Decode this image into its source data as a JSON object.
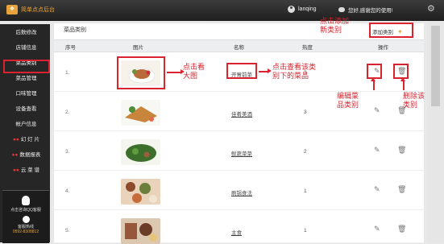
{
  "topbar": {
    "logo_mark": "❖",
    "logo_text": "简单点点后台",
    "username": "lanqing",
    "message": "您好,感谢您的使用!",
    "settings_icon": "gear-icon"
  },
  "sidebar": {
    "items": [
      {
        "label": "后数修改",
        "tag": ""
      },
      {
        "label": "店铺信息",
        "tag": ""
      },
      {
        "label": "菜品类别",
        "tag": "",
        "active": true
      },
      {
        "label": "菜品管理",
        "tag": ""
      },
      {
        "label": "口味管理",
        "tag": ""
      },
      {
        "label": "设备查看",
        "tag": ""
      },
      {
        "label": "帐户信息",
        "tag": ""
      },
      {
        "label": "幻 灯 片",
        "tag": "●●"
      },
      {
        "label": "数据报表",
        "tag": "●●"
      },
      {
        "label": "云 菜 谱",
        "tag": "●●"
      }
    ],
    "support": {
      "qq_text": "点击咨询QQ客服",
      "phone_label": "客服热线",
      "phone_number": "0592-8308812"
    }
  },
  "page": {
    "title": "菜品类别",
    "add_label": "添加类别",
    "columns": [
      "序号",
      "图片",
      "名称",
      "热度",
      "操作"
    ],
    "rows": [
      {
        "num": "1.",
        "name": "开胃前菜",
        "hot": "3",
        "img_colors": [
          "#f6f1ea",
          "#b86a3a",
          "#6f8f3a"
        ]
      },
      {
        "num": "2.",
        "name": "佳肴美酒",
        "hot": "3",
        "img_colors": [
          "#f7f7f4",
          "#c8863d",
          "#4f8d36"
        ]
      },
      {
        "num": "3.",
        "name": "鲜蔬菜菜",
        "hot": "2",
        "img_colors": [
          "#f5f5ef",
          "#3c6f2b",
          "#9b5d3d"
        ]
      },
      {
        "num": "4.",
        "name": "刷锅食法",
        "hot": "1",
        "img_colors": [
          "#e9d3bb",
          "#8d4a2c",
          "#6b7e3a"
        ]
      },
      {
        "num": "5.",
        "name": "主食",
        "hot": "1",
        "img_colors": [
          "#dcc7b1",
          "#97573a",
          "#6b3c28"
        ]
      }
    ],
    "edit_icon": "pencil-icon",
    "delete_icon": "trash-icon"
  },
  "annotations": {
    "add": "点击添加\n新类别",
    "view_image": "点击看\n大图",
    "view_category": "点击查看该类\n别下的菜品",
    "edit": "编辑菜\n品类别",
    "delete": "删除该\n类别"
  },
  "colors": {
    "accent": "#e8a33c",
    "annotation": "#d9232e",
    "sidebar": "#262626"
  }
}
